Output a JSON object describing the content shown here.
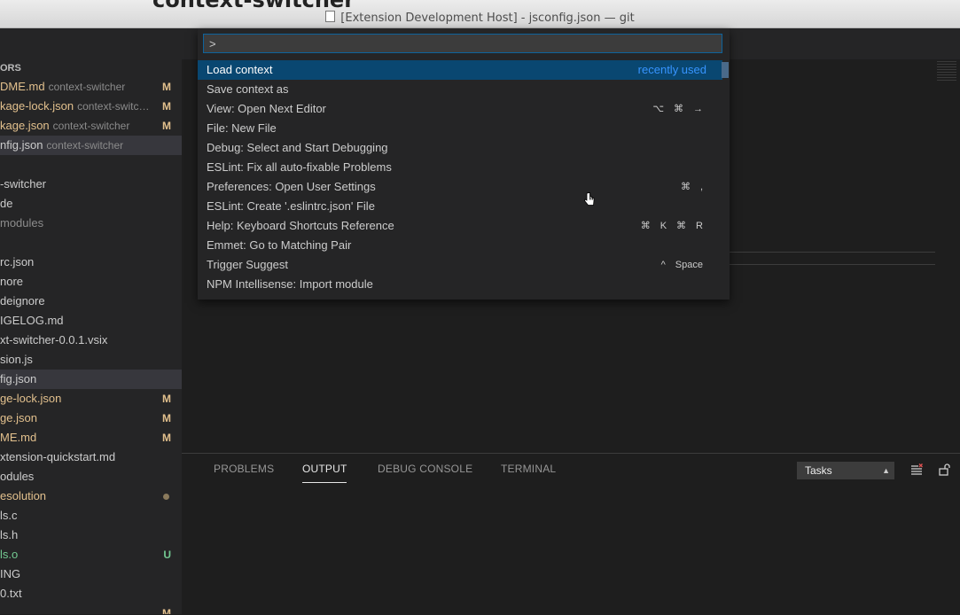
{
  "window": {
    "title": "[Extension Development Host] - jsconfig.json — git",
    "behind_title": "context-switcher"
  },
  "sidebar": {
    "section_header": "ORS",
    "items": [
      {
        "name": "DME.md",
        "desc": "context-switcher",
        "badge": "M",
        "style": "modified"
      },
      {
        "name": "kage-lock.json",
        "desc": "context-switc…",
        "badge": "M",
        "style": "modified"
      },
      {
        "name": "kage.json",
        "desc": "context-switcher",
        "badge": "M",
        "style": "modified"
      },
      {
        "name": "nfig.json",
        "desc": "context-switcher",
        "badge": "",
        "style": "normal"
      },
      {
        "name": "",
        "desc": "",
        "badge": "",
        "style": "normal"
      },
      {
        "name": "-switcher",
        "desc": "",
        "badge": "",
        "style": "normal"
      },
      {
        "name": "de",
        "desc": "",
        "badge": "",
        "style": "normal"
      },
      {
        "name": "modules",
        "desc": "",
        "badge": "",
        "style": "dim"
      },
      {
        "name": "",
        "desc": "",
        "badge": "",
        "style": "normal"
      },
      {
        "name": "rc.json",
        "desc": "",
        "badge": "",
        "style": "normal"
      },
      {
        "name": "nore",
        "desc": "",
        "badge": "",
        "style": "normal"
      },
      {
        "name": "deignore",
        "desc": "",
        "badge": "",
        "style": "normal"
      },
      {
        "name": "IGELOG.md",
        "desc": "",
        "badge": "",
        "style": "normal"
      },
      {
        "name": "xt-switcher-0.0.1.vsix",
        "desc": "",
        "badge": "",
        "style": "normal"
      },
      {
        "name": "sion.js",
        "desc": "",
        "badge": "",
        "style": "normal"
      },
      {
        "name": "fig.json",
        "desc": "",
        "badge": "",
        "style": "normal"
      },
      {
        "name": "ge-lock.json",
        "desc": "",
        "badge": "M",
        "style": "modified"
      },
      {
        "name": "ge.json",
        "desc": "",
        "badge": "M",
        "style": "modified"
      },
      {
        "name": "ME.md",
        "desc": "",
        "badge": "M",
        "style": "modified"
      },
      {
        "name": "xtension-quickstart.md",
        "desc": "",
        "badge": "",
        "style": "normal"
      },
      {
        "name": "odules",
        "desc": "",
        "badge": "",
        "style": "normal"
      },
      {
        "name": "esolution",
        "desc": "",
        "badge": "",
        "style": "modified"
      },
      {
        "name": "ls.c",
        "desc": "",
        "badge": "",
        "style": "normal"
      },
      {
        "name": "ls.h",
        "desc": "",
        "badge": "",
        "style": "normal"
      },
      {
        "name": "ls.o",
        "desc": "",
        "badge": "U",
        "style": "untracked"
      },
      {
        "name": "ING",
        "desc": "",
        "badge": "",
        "style": "normal"
      },
      {
        "name": "0.txt",
        "desc": "",
        "badge": "",
        "style": "normal"
      },
      {
        "name": "",
        "desc": "",
        "badge": "M",
        "style": "modified"
      }
    ]
  },
  "palette": {
    "input_value": ">",
    "items": [
      {
        "label": "Load context",
        "hint": "recently used",
        "keys": []
      },
      {
        "label": "Save context as",
        "hint": "",
        "keys": []
      },
      {
        "label": "View: Open Next Editor",
        "hint": "",
        "keys": [
          "⌥",
          "⌘",
          "→"
        ]
      },
      {
        "label": "File: New File",
        "hint": "",
        "keys": []
      },
      {
        "label": "Debug: Select and Start Debugging",
        "hint": "",
        "keys": []
      },
      {
        "label": "ESLint: Fix all auto-fixable Problems",
        "hint": "",
        "keys": []
      },
      {
        "label": "Preferences: Open User Settings",
        "hint": "",
        "keys": [
          "⌘",
          ","
        ]
      },
      {
        "label": "ESLint: Create '.eslintrc.json' File",
        "hint": "",
        "keys": []
      },
      {
        "label": "Help: Keyboard Shortcuts Reference",
        "hint": "",
        "keys": [
          "⌘",
          "K",
          "⌘",
          "R"
        ]
      },
      {
        "label": "Emmet: Go to Matching Pair",
        "hint": "",
        "keys": []
      },
      {
        "label": "Trigger Suggest",
        "hint": "",
        "keys": [
          "^",
          "Space"
        ]
      },
      {
        "label": "NPM Intellisense: Import module",
        "hint": "",
        "keys": []
      }
    ]
  },
  "panel": {
    "tabs": [
      "PROBLEMS",
      "OUTPUT",
      "DEBUG CONSOLE",
      "TERMINAL"
    ],
    "active_tab": "OUTPUT",
    "tasks_select": "Tasks"
  },
  "colors": {
    "accent": "#094771",
    "modified": "#e2c08d",
    "untracked": "#73c991",
    "hint": "#3794ff"
  }
}
